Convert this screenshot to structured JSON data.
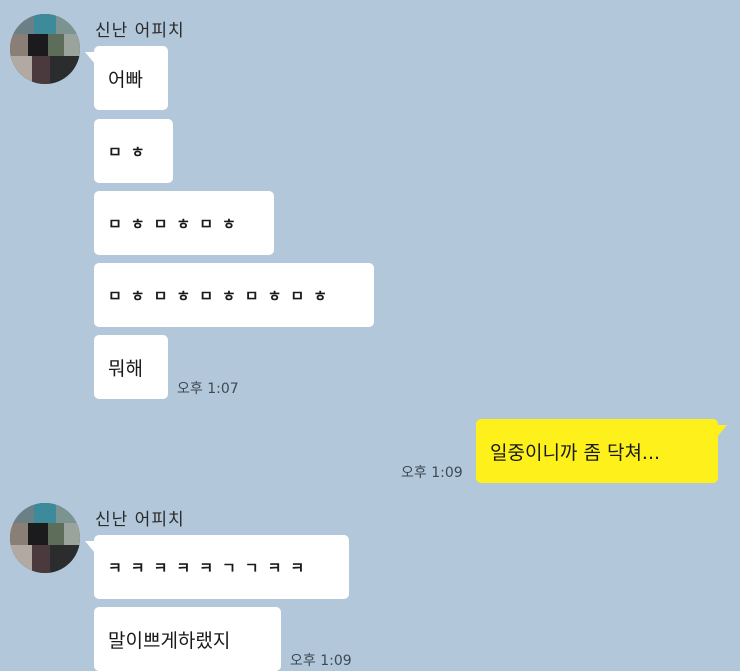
{
  "chat": {
    "group1": {
      "sender": "신난 어피치",
      "messages": [
        "어빠",
        "ㅁㅎ",
        "ㅁㅎㅁㅎㅁㅎ",
        "ㅁㅎㅁㅎㅁㅎㅁㅎㅁㅎ",
        "뭐해"
      ],
      "time": "오후 1:07"
    },
    "mine": {
      "message": "일중이니까 좀 닥쳐...",
      "time": "오후 1:09"
    },
    "group2": {
      "sender": "신난 어피치",
      "messages": [
        "ㅋㅋㅋㅋㅋㄱㄱㅋㅋ",
        "말이쁘게하랬지"
      ],
      "time": "오후 1:09"
    }
  },
  "colors": {
    "background": "#b2c7d9",
    "incoming_bubble": "#ffffff",
    "outgoing_bubble": "#fef01b"
  },
  "icons": {
    "avatar": "pixelated-avatar"
  }
}
